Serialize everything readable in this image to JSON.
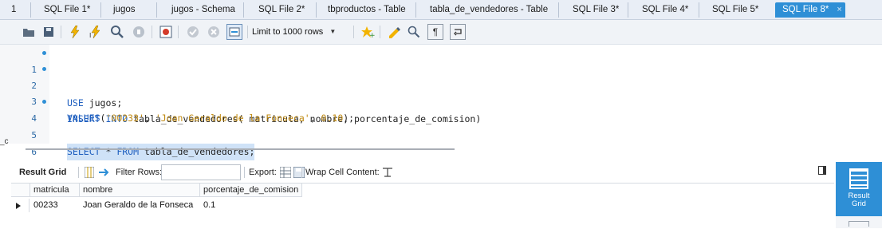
{
  "tabs": [
    {
      "label": "1"
    },
    {
      "label": "SQL File 1*"
    },
    {
      "label": "jugos"
    },
    {
      "label": "jugos - Schema"
    },
    {
      "label": "SQL File 2*"
    },
    {
      "label": "tbproductos - Table"
    },
    {
      "label": "tabla_de_vendedores - Table"
    },
    {
      "label": "SQL File 3*"
    },
    {
      "label": "SQL File 4*"
    },
    {
      "label": "SQL File 5*"
    },
    {
      "label": "SQL File 8*",
      "close": "×"
    }
  ],
  "toolbar": {
    "limit_select": "Limit to 1000 rows",
    "icons": [
      "open-folder-icon",
      "save-icon",
      "execute-icon",
      "execute-current-icon",
      "explain-icon",
      "stop-icon",
      "toggle-error-icon",
      "commit-icon",
      "rollback-icon",
      "autocommit-icon",
      "bookmark-icon",
      "beautify-icon",
      "find-icon",
      "invisible-chars-icon",
      "wrap-icon"
    ]
  },
  "editor": {
    "line_numbers": [
      "1",
      "2",
      "3",
      "4",
      "5",
      "6"
    ],
    "lines": {
      "l1_kw": "USE",
      "l1_rest": " jugos;",
      "l2_kw": "INSERT INTO",
      "l2_rest": " tabla_de_vendedores( matricula, nombre, porcentaje_de_comision)",
      "l3_kw": "VALUES",
      "l3_open": "(",
      "l3_s1": "'00233'",
      "l3_c1": ", ",
      "l3_s2": "'Joan Geraldo de la Fonseca'",
      "l3_c2": ", ",
      "l3_num": "0.10",
      "l3_close": ");",
      "l4_kw1": "SELECT",
      "l4_mid": " * ",
      "l4_kw2": "FROM",
      "l4_rest": " tabla_de_vendedores;"
    },
    "edge_mark": "_c"
  },
  "result_toolbar": {
    "result_grid": "Result Grid",
    "filter_rows": "Filter Rows:",
    "filter_value": "",
    "export": "Export:",
    "wrap": "Wrap Cell Content:"
  },
  "grid": {
    "columns": [
      "matricula",
      "nombre",
      "porcentaje_de_comision"
    ],
    "rows": [
      [
        "00233",
        "Joan Geraldo de la Fonseca",
        "0.1"
      ]
    ]
  },
  "side_panel": {
    "result_grid_label_1": "Result",
    "result_grid_label_2": "Grid"
  },
  "colors": {
    "accent": "#2e8fd6",
    "keyword": "#1f5fbf",
    "string": "#c08a12",
    "selection": "#cfe2f7"
  }
}
